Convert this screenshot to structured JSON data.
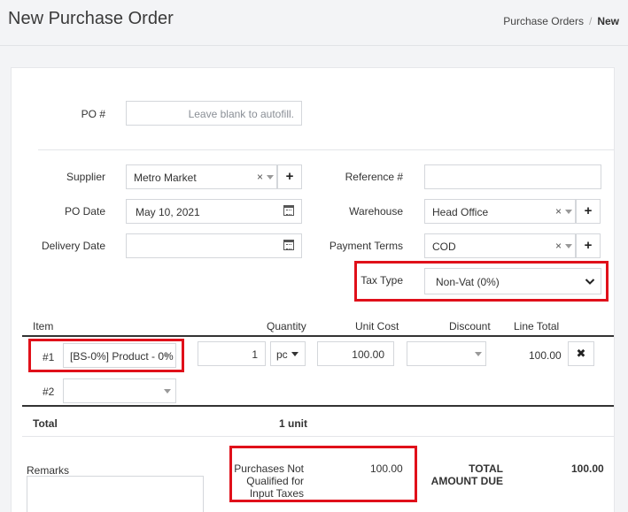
{
  "header": {
    "title": "New Purchase Order",
    "breadcrumb": {
      "parent": "Purchase Orders",
      "separator": "/",
      "current": "New"
    }
  },
  "form": {
    "po_label": "PO #",
    "po_placeholder": "Leave blank to autofill.",
    "supplier_label": "Supplier",
    "supplier_value": "Metro Market",
    "po_date_label": "PO Date",
    "po_date_value": "May 10, 2021",
    "delivery_date_label": "Delivery Date",
    "delivery_date_value": "",
    "reference_label": "Reference #",
    "reference_value": "",
    "warehouse_label": "Warehouse",
    "warehouse_value": "Head Office",
    "payment_terms_label": "Payment Terms",
    "payment_terms_value": "COD",
    "tax_type_label": "Tax Type",
    "tax_type_value": "Non-Vat (0%)",
    "clear_symbol": "×",
    "add_symbol": "+"
  },
  "table": {
    "headers": {
      "item": "Item",
      "quantity": "Quantity",
      "unit_cost": "Unit Cost",
      "discount": "Discount",
      "line_total": "Line Total"
    },
    "rows": [
      {
        "index": "#1",
        "item": "[BS-0%] Product - 0%",
        "quantity": "1",
        "unit": "pc",
        "unit_cost": "100.00",
        "discount": "",
        "line_total": "100.00",
        "remove_symbol": "✖"
      },
      {
        "index": "#2",
        "item": ""
      }
    ],
    "total_label": "Total",
    "total_units": "1 unit"
  },
  "summary": {
    "remarks_label": "Remarks",
    "not_qualified_label": "Purchases Not Qualified for Input Taxes",
    "not_qualified_value": "100.00",
    "total_due_label": "TOTAL AMOUNT DUE",
    "total_due_value": "100.00"
  },
  "colors": {
    "highlight": "#e0101a",
    "background": "#f3f4f6",
    "card": "#ffffff"
  }
}
